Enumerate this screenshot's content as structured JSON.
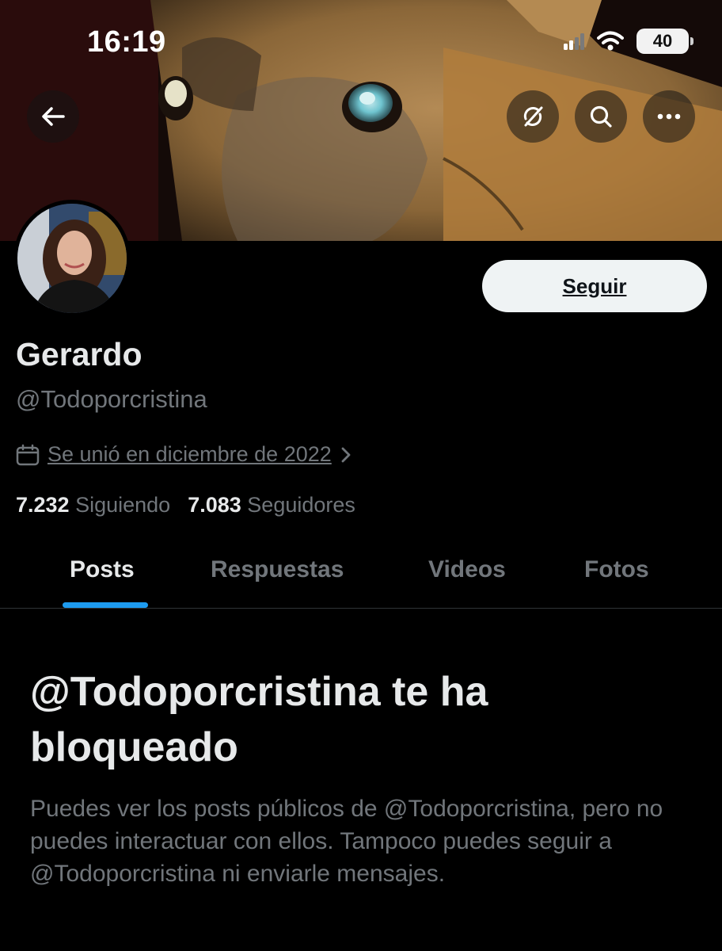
{
  "status_bar": {
    "time": "16:19",
    "battery": "40"
  },
  "header": {
    "back_icon": "arrow-left-icon",
    "actions": [
      "no-sync-icon",
      "search-icon",
      "more-icon"
    ]
  },
  "profile": {
    "name": "Gerardo",
    "handle": "@Todoporcristina",
    "follow_label": "Seguir",
    "joined": "Se unió en diciembre de 2022",
    "following_count": "7.232",
    "following_label": "Siguiendo",
    "followers_count": "7.083",
    "followers_label": "Seguidores"
  },
  "tabs": [
    {
      "label": "Posts",
      "active": true
    },
    {
      "label": "Respuestas",
      "active": false
    },
    {
      "label": "Videos",
      "active": false
    },
    {
      "label": "Fotos",
      "active": false
    }
  ],
  "blocked": {
    "title": "@Todoporcristina te ha bloqueado",
    "body": "Puedes ver los posts públicos de @Todoporcristina, pero no puedes interactuar con ellos. Tampoco puedes seguir a @Todoporcristina ni enviarle mensajes."
  },
  "colors": {
    "accent": "#1d9bf0",
    "background": "#000000",
    "muted": "#71767b"
  }
}
